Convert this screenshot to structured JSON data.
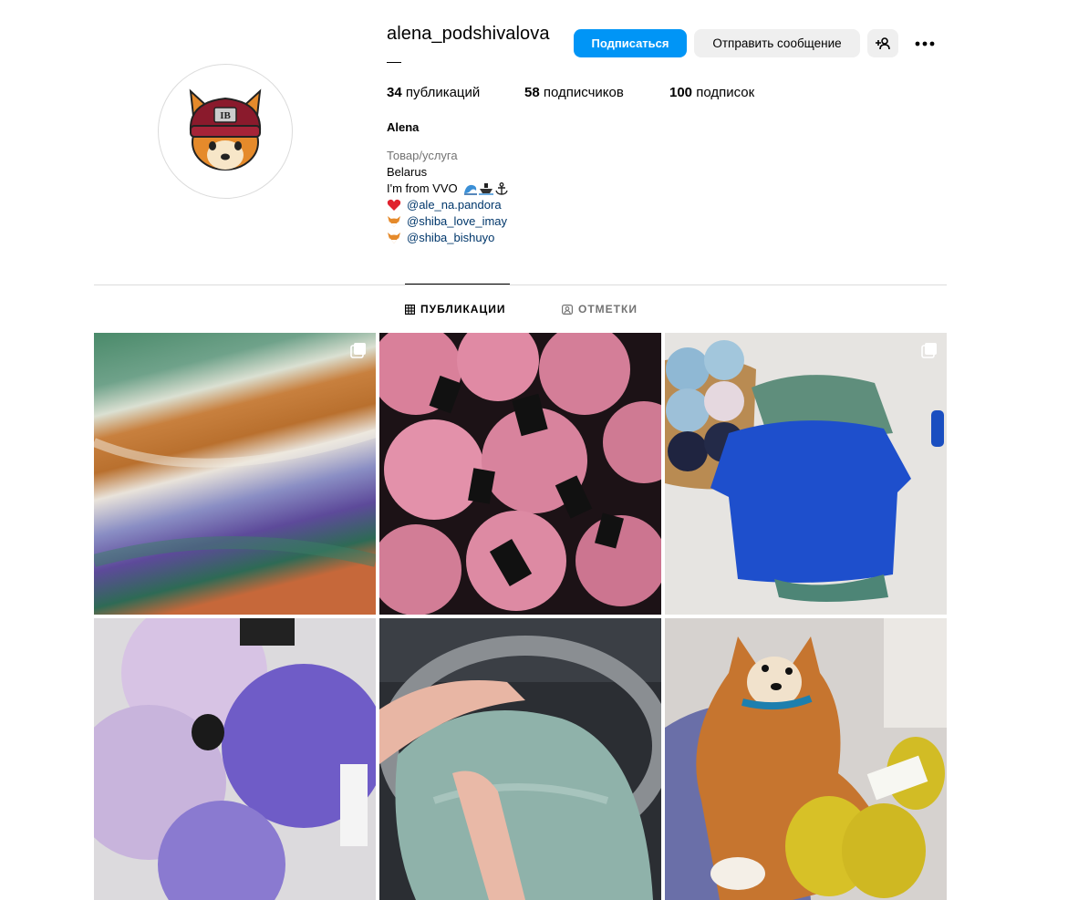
{
  "profile": {
    "username": "alena_podshivalova",
    "follow_label": "Подписаться",
    "message_label": "Отправить сообщение",
    "stats": {
      "posts_count": "34",
      "posts_label": "публикаций",
      "followers_count": "58",
      "followers_label": "подписчиков",
      "following_count": "100",
      "following_label": "подписок"
    },
    "display_name": "Alena",
    "category": "Товар/услуга",
    "bio_lines": [
      "Belarus",
      "I'm from VVO"
    ],
    "links": [
      "@ale_na.pandora",
      "@shiba_love_imay",
      "@shiba_bishuyo"
    ],
    "avatar_text": "IB"
  },
  "tabs": [
    {
      "label": "ПУБЛИКАЦИИ",
      "icon": "grid-icon",
      "active": true
    },
    {
      "label": "ОТМЕТКИ",
      "icon": "tag-person-icon",
      "active": false
    }
  ],
  "posts": [
    {
      "name": "post-striped-mohair-sweater",
      "multi": true
    },
    {
      "name": "post-pink-yarn-skeins",
      "multi": false
    },
    {
      "name": "post-blue-mohair-sweater",
      "multi": true
    },
    {
      "name": "post-purple-mohair-skeins",
      "multi": false
    },
    {
      "name": "post-sparkle-knit-in-car",
      "multi": false
    },
    {
      "name": "post-shiba-with-yellow-yarn",
      "multi": false
    }
  ],
  "colors": {
    "accent": "#0095f6",
    "secondary_button": "#efefef",
    "link": "#00376b",
    "muted_text": "#737373",
    "divider": "#dbdbdb"
  }
}
